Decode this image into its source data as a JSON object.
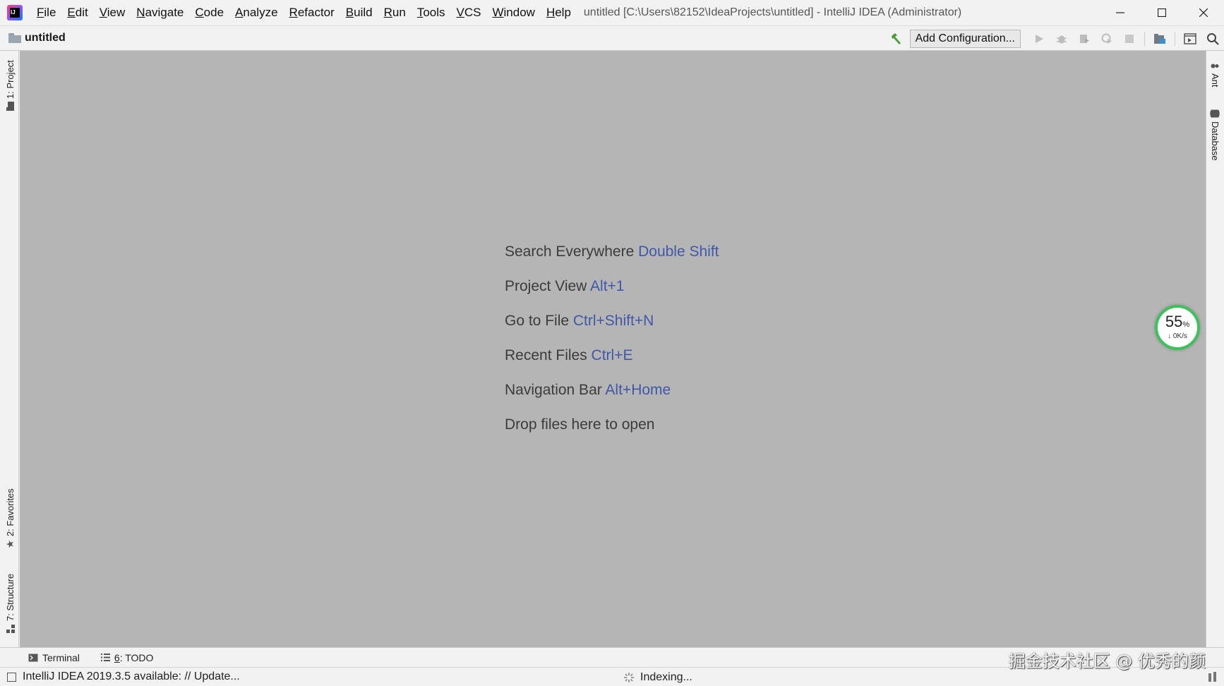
{
  "app": {
    "logo_text": "IJ",
    "window_title": "untitled [C:\\Users\\82152\\IdeaProjects\\untitled] - IntelliJ IDEA (Administrator)"
  },
  "menu": [
    "File",
    "Edit",
    "View",
    "Navigate",
    "Code",
    "Analyze",
    "Refactor",
    "Build",
    "Run",
    "Tools",
    "VCS",
    "Window",
    "Help"
  ],
  "window_controls": [
    "minimize-icon",
    "maximize-icon",
    "close-icon"
  ],
  "navbar": {
    "project_name": "untitled",
    "add_configuration_label": "Add Configuration...",
    "toolbar_icons": [
      "hammer-icon",
      "run-icon",
      "debug-icon",
      "coverage-icon",
      "profile-icon",
      "stop-icon",
      "project-structure-icon",
      "terminal-window-icon",
      "search-icon"
    ]
  },
  "left_stripe": {
    "project_tab": "1: Project",
    "favorites_tab": "2: Favorites",
    "structure_tab": "7: Structure"
  },
  "right_stripe": {
    "ant_tab": "Ant",
    "database_tab": "Database"
  },
  "editor_hints": [
    {
      "label": "Search Everywhere ",
      "shortcut": "Double Shift"
    },
    {
      "label": "Project View ",
      "shortcut": "Alt+1"
    },
    {
      "label": "Go to File ",
      "shortcut": "Ctrl+Shift+N"
    },
    {
      "label": "Recent Files ",
      "shortcut": "Ctrl+E"
    },
    {
      "label": "Navigation Bar ",
      "shortcut": "Alt+Home"
    },
    {
      "label": "Drop files here to open",
      "shortcut": ""
    }
  ],
  "speed_widget": {
    "percent": "55",
    "percent_sign": "%",
    "rate": "↓ 0K/s"
  },
  "tool_windows": {
    "terminal": "Terminal",
    "todo_number": "6",
    "todo_label": ": TODO"
  },
  "status": {
    "message": "IntelliJ IDEA 2019.3.5 available: // Update...",
    "indexing": "Indexing..."
  },
  "watermark": "掘金技术社区 @ 优秀的颜",
  "colors": {
    "editor_bg": "#b5b5b5",
    "shortcut": "#3f58a8",
    "chrome": "#f2f2f2",
    "speed_ring": "#3bc25a"
  }
}
